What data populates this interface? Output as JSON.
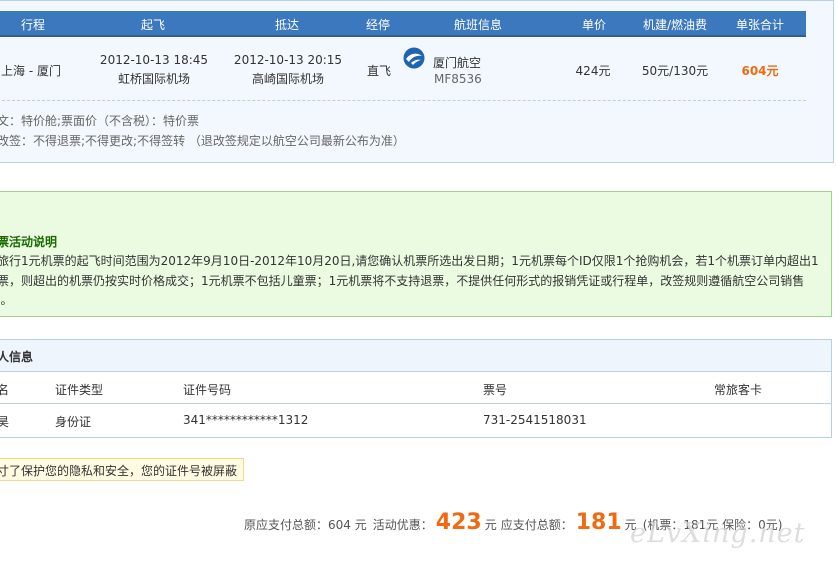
{
  "flight_table": {
    "headers": {
      "route": "行程",
      "depart": "起飞",
      "arrive": "抵达",
      "stop": "经停",
      "flight_info": "航班信息",
      "price": "单价",
      "tax": "机建/燃油费",
      "total": "单张合计"
    },
    "row": {
      "route": "上海 - 厦门",
      "depart_time": "2012-10-13 18:45",
      "depart_airport": "虹桥国际机场",
      "arrive_time": "2012-10-13 20:15",
      "arrive_airport": "高崎国际机场",
      "stop": "直飞",
      "airline": "厦门航空",
      "flight_no": "MF8536",
      "price": "424元",
      "tax": "50元/130元",
      "total": "604元"
    },
    "rules": {
      "cabin": "文：特价舱;票面价（不含税）：特价票",
      "change": "改签：不得退票;不得更改;不得签转 （退改签规定以航空公司最新公布为准）"
    }
  },
  "promo": {
    "title": "票活动说明",
    "lines": [
      "旅行1元机票的起飞时间范围为2012年9月10日-2012年10月20日,请您确认机票所选出发日期；1元机票每个ID仅限1个抢购机会，若1个机票订单内超出1",
      "票，则超出的机票仍按实时价格成交；1元机票不包括儿童票；1元机票将不支持退票，不提供任何形式的报销凭证或行程单，改签规则遵循航空公司销售",
      "J。"
    ]
  },
  "passenger": {
    "title": "人信息",
    "headers": {
      "name": "名",
      "id_type": "证件类型",
      "id_no": "证件号码",
      "ticket_no": "票号",
      "frequent": "常旅客卡"
    },
    "row": {
      "name": "昊",
      "id_type": "身份证",
      "id_no": "341************1312",
      "ticket_no": "731-2541518031",
      "frequent": ""
    }
  },
  "privacy_note": "寸了保护您的隐私和安全，您的证件号被屏蔽",
  "totals": {
    "original_label": "原应支付总额：",
    "original_value": "604 元",
    "discount_label": "活动优惠：",
    "discount_value": "423",
    "discount_unit": "元",
    "pay_label": "应支付总额：",
    "pay_value": "181",
    "pay_unit": "元",
    "breakdown": "(机票：181元 保险：0元)"
  },
  "watermark": "eLvXing.net",
  "colors": {
    "header_blue": "#3b78bd",
    "accent_orange": "#ef6a10",
    "promo_green": "#1a6a00"
  }
}
